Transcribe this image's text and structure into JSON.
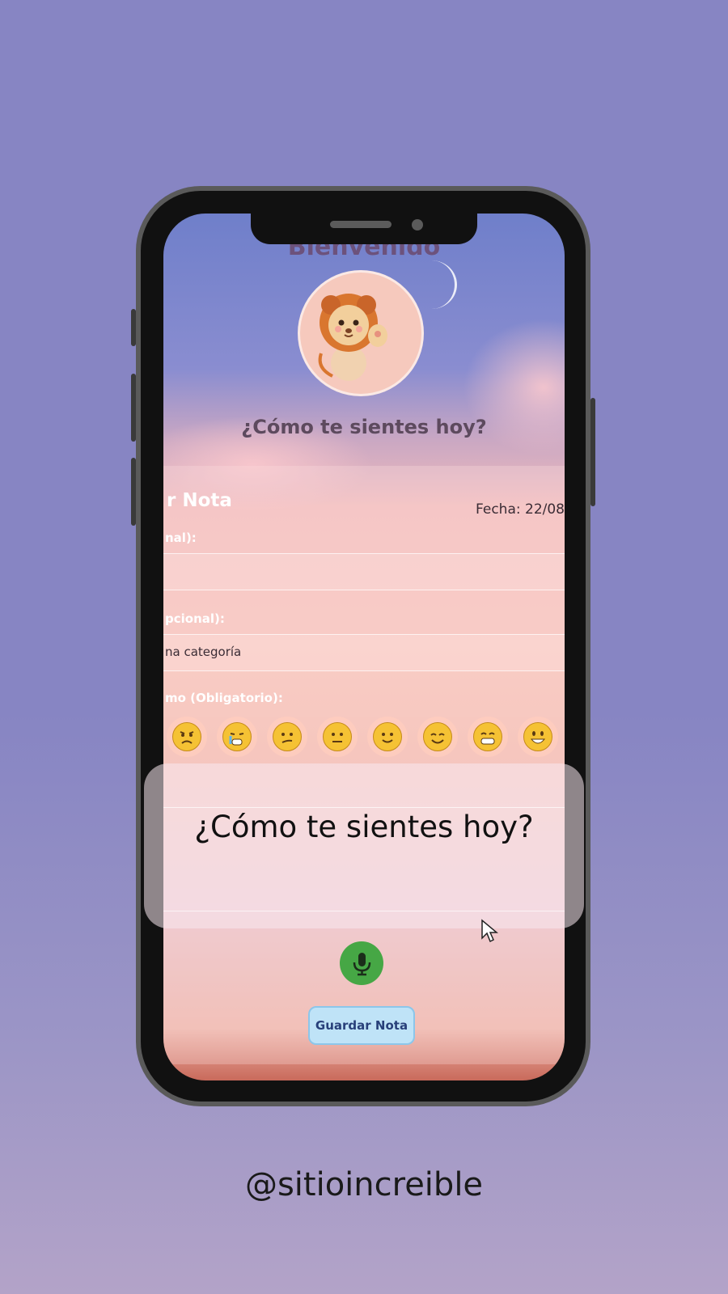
{
  "app": {
    "greeting": "Bienvenido",
    "question": "¿Cómo te sientes hoy?"
  },
  "note_card": {
    "title": "r Nota",
    "date": "Fecha: 22/08",
    "field1_label": "nal):",
    "field2_label": "pcional):",
    "category_select": "na categoría",
    "mood_label": "mo (Obligatorio):",
    "moods": [
      {
        "icon": "angry-face-icon"
      },
      {
        "icon": "crying-face-icon"
      },
      {
        "icon": "confused-face-icon"
      },
      {
        "icon": "neutral-face-icon"
      },
      {
        "icon": "slightly-smiling-face-icon"
      },
      {
        "icon": "smiling-face-icon"
      },
      {
        "icon": "grinning-face-icon"
      },
      {
        "icon": "big-smile-face-icon"
      }
    ]
  },
  "overlay": {
    "text": "¿Cómo te sientes hoy?"
  },
  "actions": {
    "mic_icon": "microphone-icon",
    "save_label": "Guardar Nota"
  },
  "footer": {
    "handle": "@sitioincreible"
  },
  "colors": {
    "background": "#8785c3",
    "mic_button": "#46a745",
    "save_button": "#bfe3f7"
  }
}
